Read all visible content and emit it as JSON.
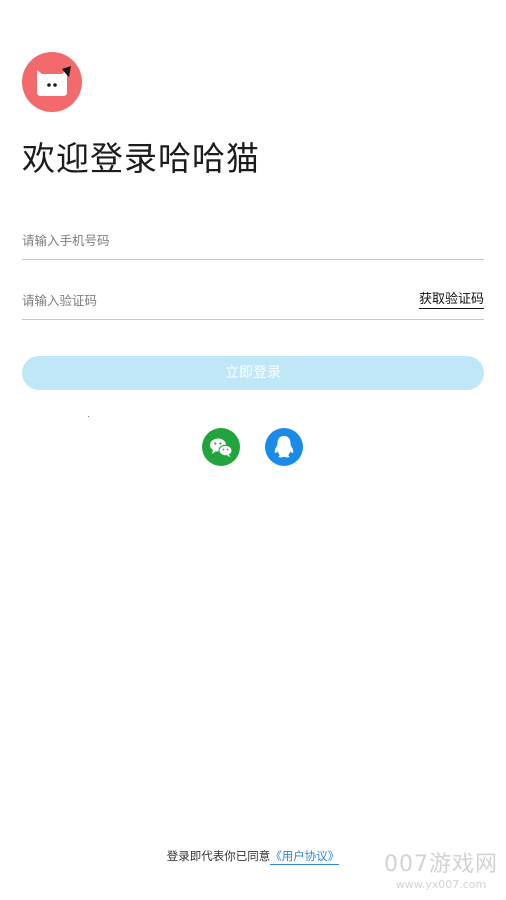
{
  "brand": {
    "logo_icon": "cat-face-icon",
    "logo_color": "#f26a6b"
  },
  "welcome_title": "欢迎登录哈哈猫",
  "phone_field": {
    "placeholder": "请输入手机号码",
    "value": ""
  },
  "code_field": {
    "placeholder": "请输入验证码",
    "value": "",
    "get_code_label": "获取验证码"
  },
  "login_button": {
    "label": "立即登录",
    "color": "#bfe7f8"
  },
  "social_login": [
    {
      "name": "wechat",
      "icon": "wechat-icon",
      "color": "#21a33d"
    },
    {
      "name": "qq",
      "icon": "qq-icon",
      "color": "#1b8be8"
    }
  ],
  "agreement": {
    "prefix": "登录即代表你已同意",
    "link_label": "《用户协议》"
  },
  "watermark": {
    "main": "007游戏网",
    "url": "www.yx007.com"
  }
}
